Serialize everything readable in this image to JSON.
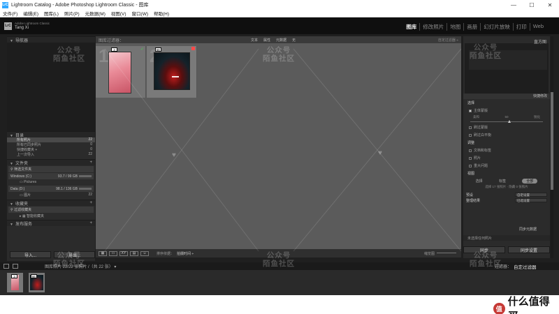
{
  "window": {
    "app_icon_text": "LrC",
    "title": "Lightroom Catalog - Adobe Photoshop Lightroom Classic - 图库",
    "minimize": "—",
    "maximize": "☐",
    "close": "✕"
  },
  "menu": [
    "文件(F)",
    "编辑(E)",
    "图库(L)",
    "照片(P)",
    "元数据(M)",
    "视图(V)",
    "窗口(W)",
    "帮助(H)"
  ],
  "identity": {
    "badge": "LrC",
    "line1": "Adobe Lightroom Classic",
    "line2": "Tang Xi"
  },
  "modules": [
    "图库",
    "修改照片",
    "地图",
    "画册",
    "幻灯片放映",
    "打印",
    "Web"
  ],
  "active_module": "图库",
  "left_panel": {
    "navigator": "导航器",
    "catalog": {
      "title": "目录",
      "items": [
        {
          "label": "所有照片",
          "count": "22"
        },
        {
          "label": "所有已同步照片",
          "count": "0"
        },
        {
          "label": "快捷收藏夹 +",
          "count": "0"
        },
        {
          "label": "上一次导入",
          "count": "22"
        }
      ]
    },
    "folders": {
      "title": "文件夹",
      "filter": "筛选文件夹",
      "volumes": [
        {
          "label": "Windows (C:)",
          "size": "93.7 / 99 GB",
          "sub": "Pictures",
          "sub_count": ""
        },
        {
          "label": "Data (D:)",
          "size": "98.1 / 136 GB",
          "sub": "图片",
          "sub_count": "22"
        }
      ]
    },
    "collections": {
      "title": "收藏夹",
      "filter": "过滤收藏夹",
      "items": [
        "智能收藏夹"
      ]
    },
    "publish": {
      "title": "发布服务"
    },
    "import_button": "导入...",
    "export_button": "导出..."
  },
  "filter_bar": {
    "title": "图库过滤器：",
    "tabs": [
      "文本",
      "属性",
      "元数据",
      "无"
    ],
    "preset": "自定过滤器 ÷"
  },
  "grid": {
    "cells": [
      {
        "index": "1",
        "badge": "3",
        "flag": "✓"
      },
      {
        "index": "2",
        "badge": "5E",
        "flag": ""
      }
    ]
  },
  "toolbar": {
    "view_icons": [
      "grid",
      "loupe",
      "compare",
      "survey",
      "people"
    ],
    "sort_label": "排序依据：",
    "sort_value": "拍摄时间 ÷",
    "thumb_label": "缩览图"
  },
  "right_panel": {
    "histogram": "直方图",
    "quick_develop_header_left": "",
    "quick_develop_header_right": "快捷修改",
    "section_select": "选择",
    "checkboxes": [
      {
        "label": "主体蒙版",
        "on": true
      },
      {
        "label": "刷过蒙版",
        "on": false
      },
      {
        "label": "刷过白平衡",
        "on": false
      }
    ],
    "slider_left": "柔和",
    "slider_right": "锐化",
    "slider_value": "50",
    "section_adjust": "调整",
    "adjust_items": [
      "文档和标签",
      "照片",
      "重大问题"
    ],
    "section_view": "视图",
    "view_options": [
      "选择",
      "标签",
      "全部"
    ],
    "view_active": "全部",
    "view_note": "选择 17 张照片 · 隐藏 0 张照片",
    "preset_label": "预设",
    "preset_value": "自定设置",
    "apply_label": "整理结果",
    "apply_value": "已选设置",
    "sync_metadata": "同步元数据",
    "footer": "未选择任何照片",
    "sync_button": "同步",
    "sync_settings_button": "同步设置"
  },
  "filmstrip_bar": {
    "crumbs": "图库照片  22/22 张照片 /（共 22 张）  ▾",
    "filter_label": "过滤器：",
    "custom_filter": "自定过滤器"
  },
  "filmstrip": [
    {
      "badge": "3"
    },
    {
      "badge": "5E"
    }
  ],
  "watermark": {
    "line1": "公众号",
    "line2": "陌鱼社区"
  },
  "footer_brand": {
    "icon": "值",
    "text": "什么值得买"
  },
  "colors": {
    "accent_green": "#3fd24a",
    "reject_red": "#ff4a4a",
    "panel_bg": "#2b2b2b",
    "grid_bg": "#5b5b5b"
  }
}
